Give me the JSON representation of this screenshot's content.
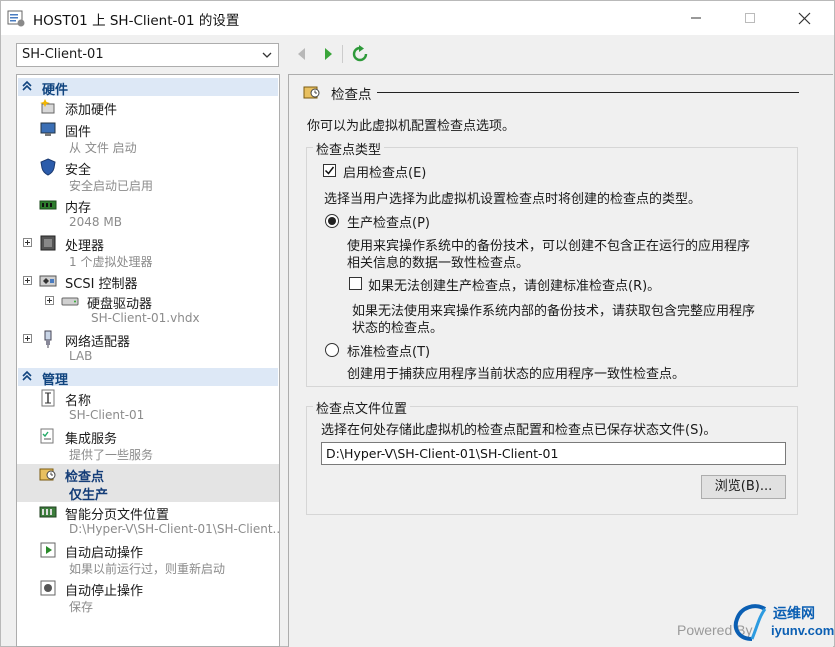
{
  "window": {
    "title": "HOST01 上 SH-Client-01 的设置",
    "minimize": "—",
    "maximize": "☐",
    "close": "✕"
  },
  "vm_select": {
    "value": "SH-Client-01"
  },
  "tree": {
    "hardware_header": "硬件",
    "management_header": "管理",
    "hardware_items": [
      {
        "label": "添加硬件",
        "sub": ""
      },
      {
        "label": "固件",
        "sub": "从 文件 启动"
      },
      {
        "label": "安全",
        "sub": "安全启动已启用"
      },
      {
        "label": "内存",
        "sub": "2048 MB"
      },
      {
        "label": "处理器",
        "sub": "1 个虚拟处理器"
      },
      {
        "label": "SCSI 控制器",
        "sub": ""
      },
      {
        "label": "硬盘驱动器",
        "sub": "SH-Client-01.vhdx"
      },
      {
        "label": "网络适配器",
        "sub": "LAB"
      }
    ],
    "management_items": [
      {
        "label": "名称",
        "sub": "SH-Client-01"
      },
      {
        "label": "集成服务",
        "sub": "提供了一些服务"
      },
      {
        "label": "检查点",
        "sub": "仅生产"
      },
      {
        "label": "智能分页文件位置",
        "sub": "D:\\Hyper-V\\SH-Client-01\\SH-Client..."
      },
      {
        "label": "自动启动操作",
        "sub": "如果以前运行过，则重新启动"
      },
      {
        "label": "自动停止操作",
        "sub": "保存"
      }
    ]
  },
  "panel": {
    "section_title": "检查点",
    "intro": "你可以为此虚拟机配置检查点选项。",
    "type_group": {
      "legend": "检查点类型",
      "enable_label": "启用检查点(E)",
      "enable_checked": true,
      "choose_text": "选择当用户选择为此虚拟机设置检查点时将创建的检查点的类型。",
      "production_label": "生产检查点(P)",
      "production_selected": true,
      "production_desc_1": "使用来宾操作系统中的备份技术，可以创建不包含正在运行的应用程序",
      "production_desc_2": "相关信息的数据一致性检查点。",
      "fallback_label": "如果无法创建生产检查点，请创建标准检查点(R)。",
      "fallback_checked": false,
      "fallback_desc_1": "如果无法使用来宾操作系统内部的备份技术，请获取包含完整应用程序",
      "fallback_desc_2": "状态的检查点。",
      "standard_label": "标准检查点(T)",
      "standard_selected": false,
      "standard_desc": "创建用于捕获应用程序当前状态的应用程序一致性检查点。"
    },
    "location_group": {
      "legend": "检查点文件位置",
      "desc": "选择在何处存储此虚拟机的检查点配置和检查点已保存状态文件(S)。",
      "path": "D:\\Hyper-V\\SH-Client-01\\SH-Client-01",
      "browse_label": "浏览(B)..."
    }
  },
  "watermark": {
    "powered": "Powered By",
    "site_cn": "运维网",
    "site_en": "iyunv.com"
  },
  "colors": {
    "accent_blue": "#10447f",
    "category_bg": "#dde8f6",
    "nav_green": "#3aa53a"
  }
}
